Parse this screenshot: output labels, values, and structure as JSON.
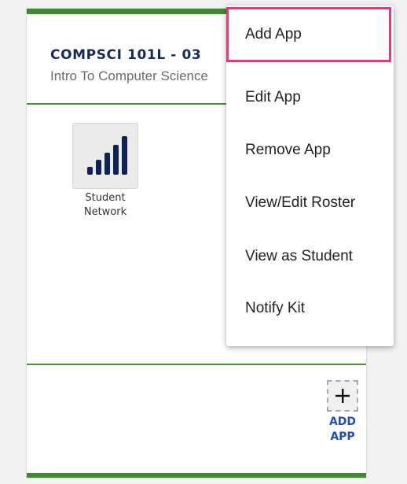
{
  "course": {
    "code": "COMPSCI 101L - 03",
    "name": "Intro To Computer Science"
  },
  "apps": [
    {
      "label_line1": "Student",
      "label_line2": "Network",
      "icon": "signal-bars-icon"
    }
  ],
  "add_app": {
    "icon": "plus-icon",
    "label_line1": "ADD",
    "label_line2": "APP"
  },
  "menu": {
    "items": [
      {
        "label": "Add App",
        "highlighted": true
      },
      {
        "label": "Edit App"
      },
      {
        "label": "Remove App"
      },
      {
        "label": "View/Edit Roster"
      },
      {
        "label": "View as Student"
      },
      {
        "label": "Notify Kit"
      }
    ]
  },
  "colors": {
    "accent_green": "#3f8a2e",
    "title_navy": "#162a5a",
    "link_blue": "#1f4fb5",
    "highlight_pink": "#e8377a"
  }
}
